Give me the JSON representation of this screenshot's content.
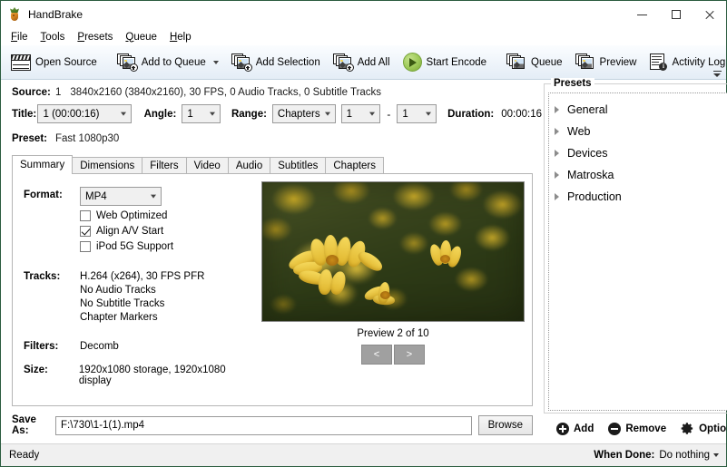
{
  "window": {
    "title": "HandBrake",
    "app_icon": "pineapple-icon",
    "controls": {
      "minimize": "minimize-icon",
      "maximize": "maximize-icon",
      "close": "close-icon"
    }
  },
  "menubar": [
    {
      "label": "File",
      "mnemonic": "F"
    },
    {
      "label": "Tools",
      "mnemonic": "T"
    },
    {
      "label": "Presets",
      "mnemonic": "P"
    },
    {
      "label": "Queue",
      "mnemonic": "Q"
    },
    {
      "label": "Help",
      "mnemonic": "H"
    }
  ],
  "toolbar": {
    "open_source": "Open Source",
    "add_to_queue": "Add to Queue",
    "add_selection": "Add Selection",
    "add_all": "Add All",
    "start_encode": "Start Encode",
    "queue": "Queue",
    "preview": "Preview",
    "activity_log": "Activity Log",
    "log_badge": "i"
  },
  "source": {
    "label": "Source:",
    "number": "1",
    "details": "3840x2160 (3840x2160), 30 FPS, 0 Audio Tracks, 0 Subtitle Tracks"
  },
  "title_row": {
    "title_label": "Title:",
    "title_value": "1 (00:00:16)",
    "angle_label": "Angle:",
    "angle_value": "1",
    "range_label": "Range:",
    "range_value": "Chapters",
    "chapter_start": "1",
    "separator": "-",
    "chapter_end": "1",
    "duration_label": "Duration:",
    "duration_value": "00:00:16"
  },
  "preset_row": {
    "label": "Preset:",
    "value": "Fast 1080p30"
  },
  "tabs": [
    {
      "label": "Summary",
      "active": true
    },
    {
      "label": "Dimensions",
      "active": false
    },
    {
      "label": "Filters",
      "active": false
    },
    {
      "label": "Video",
      "active": false
    },
    {
      "label": "Audio",
      "active": false
    },
    {
      "label": "Subtitles",
      "active": false
    },
    {
      "label": "Chapters",
      "active": false
    }
  ],
  "summary": {
    "format_label": "Format:",
    "format_value": "MP4",
    "checkboxes": [
      {
        "label": "Web Optimized",
        "checked": false
      },
      {
        "label": "Align A/V Start",
        "checked": true
      },
      {
        "label": "iPod 5G Support",
        "checked": false
      }
    ],
    "tracks_label": "Tracks:",
    "tracks": [
      "H.264 (x264), 30 FPS PFR",
      "No Audio Tracks",
      "No Subtitle Tracks",
      "Chapter Markers"
    ],
    "filters_label": "Filters:",
    "filters_value": "Decomb",
    "size_label": "Size:",
    "size_value": "1920x1080 storage, 1920x1080 display"
  },
  "preview_pane": {
    "caption": "Preview 2 of 10",
    "prev_button": "<",
    "next_button": ">",
    "image_description": "yellow daisy flowers on dark green foliage"
  },
  "save_as": {
    "label": "Save As:",
    "path": "F:\\730\\1-1(1).mp4",
    "browse_label": "Browse"
  },
  "presets_panel": {
    "group_title": "Presets",
    "items": [
      {
        "label": "General"
      },
      {
        "label": "Web"
      },
      {
        "label": "Devices"
      },
      {
        "label": "Matroska"
      },
      {
        "label": "Production"
      }
    ],
    "actions": {
      "add": "Add",
      "remove": "Remove",
      "options": "Options"
    }
  },
  "statusbar": {
    "status": "Ready",
    "when_done_label": "When Done:",
    "when_done_value": "Do nothing"
  },
  "colors": {
    "accent_green": "#9dcb5a",
    "window_border": "#2b5c3f",
    "toolbar_bg": "#eef4fa"
  }
}
